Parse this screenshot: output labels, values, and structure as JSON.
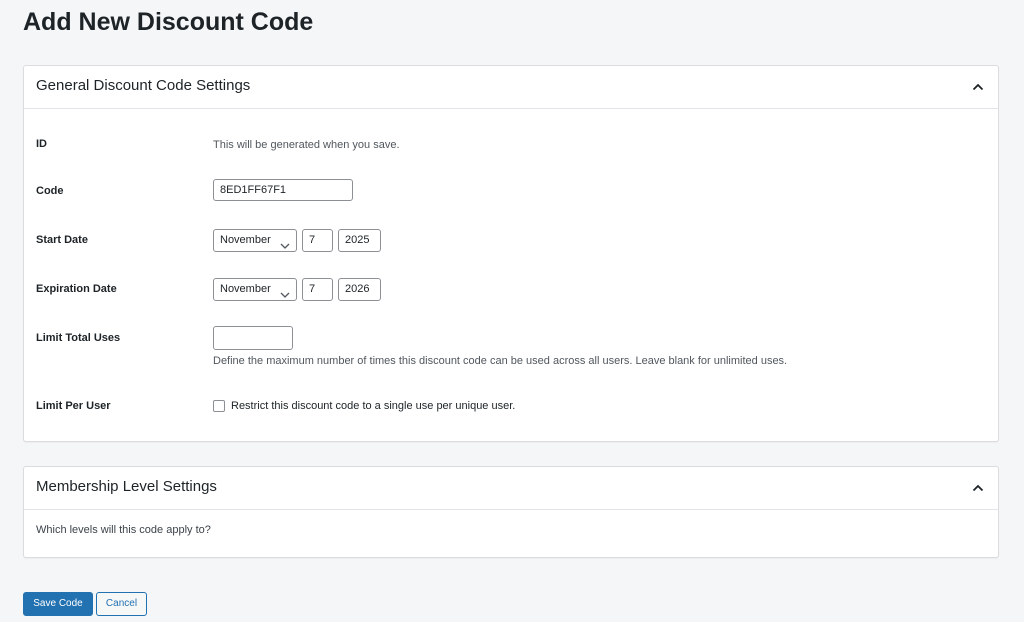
{
  "page": {
    "title": "Add New Discount Code"
  },
  "general": {
    "title": "General Discount Code Settings",
    "toggle_icon": "chevron-up-icon",
    "id_label": "ID",
    "id_help": "This will be generated when you save.",
    "code_label": "Code",
    "code_value": "8ED1FF67F1",
    "start_label": "Start Date",
    "start_month": "November",
    "start_day": "7",
    "start_year": "2025",
    "expiration_label": "Expiration Date",
    "expiration_month": "November",
    "expiration_day": "7",
    "expiration_year": "2026",
    "limit_total_label": "Limit Total Uses",
    "limit_total_value": "",
    "limit_total_help": "Define the maximum number of times this discount code can be used across all users. Leave blank for unlimited uses.",
    "limit_per_user_label": "Limit Per User",
    "limit_per_user_checkbox_label": "Restrict this discount code to a single use per unique user.",
    "limit_per_user_checked": false
  },
  "membership": {
    "title": "Membership Level Settings",
    "toggle_icon": "chevron-up-icon",
    "question": "Which levels will this code apply to?"
  },
  "actions": {
    "save_label": "Save Code",
    "cancel_label": "Cancel"
  },
  "colors": {
    "primary": "#2271b1",
    "background": "#f5f6f8",
    "panel": "#ffffff",
    "border": "#dcdcde"
  }
}
